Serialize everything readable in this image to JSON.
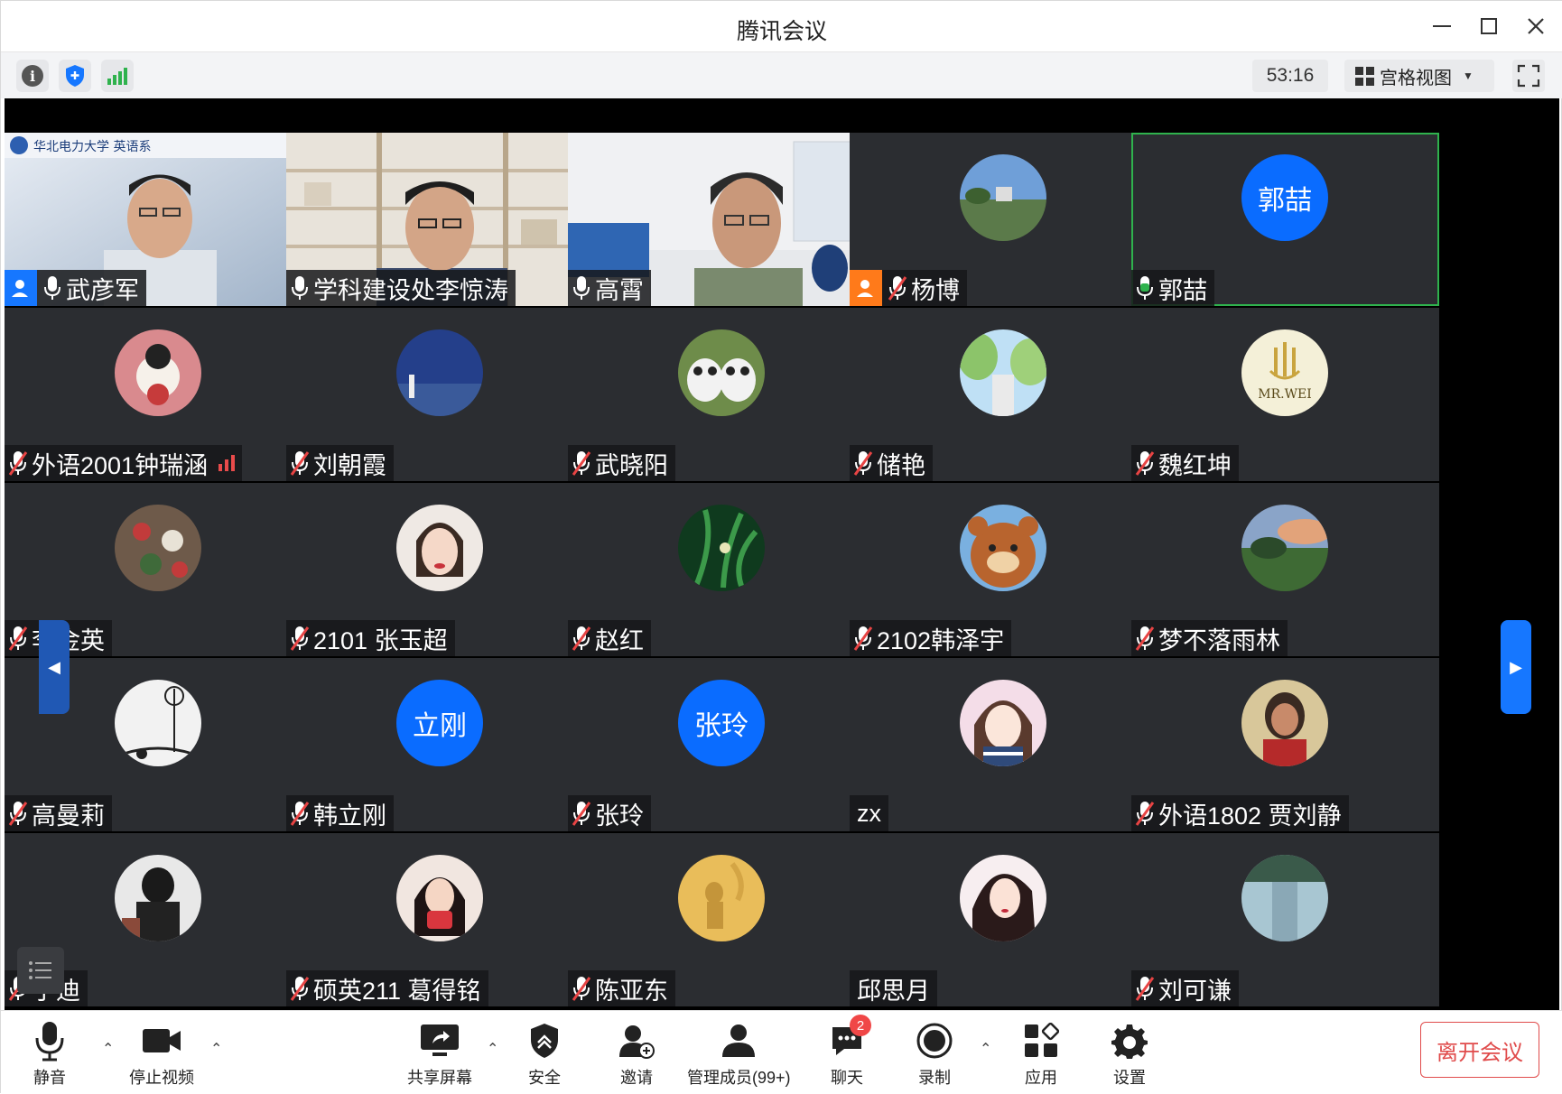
{
  "window": {
    "title": "腾讯会议"
  },
  "infobar": {
    "timer": "53:16",
    "view_mode": "宫格视图"
  },
  "participants": [
    {
      "name": "武彦军",
      "kind": "video",
      "mic": "on",
      "host": true
    },
    {
      "name": "学科建设处李惊涛",
      "kind": "video",
      "mic": "on"
    },
    {
      "name": "高霄",
      "kind": "video",
      "mic": "on"
    },
    {
      "name": "杨博",
      "kind": "photo",
      "mic": "muted",
      "cohost": true
    },
    {
      "name": "郭喆",
      "kind": "initials",
      "initials": "郭喆",
      "mic": "active"
    },
    {
      "name": "外语2001钟瑞涵",
      "kind": "photo",
      "mic": "muted",
      "signal": true
    },
    {
      "name": "刘朝霞",
      "kind": "photo",
      "mic": "muted"
    },
    {
      "name": "武晓阳",
      "kind": "photo",
      "mic": "muted"
    },
    {
      "name": "储艳",
      "kind": "photo",
      "mic": "muted"
    },
    {
      "name": "魏红坤",
      "kind": "photo",
      "mic": "muted"
    },
    {
      "name": "李金英",
      "kind": "photo",
      "mic": "muted"
    },
    {
      "name": "2101 张玉超",
      "kind": "photo",
      "mic": "muted"
    },
    {
      "name": "赵红",
      "kind": "photo",
      "mic": "muted"
    },
    {
      "name": "2102韩泽宇",
      "kind": "photo",
      "mic": "muted"
    },
    {
      "name": "梦不落雨林",
      "kind": "photo",
      "mic": "muted"
    },
    {
      "name": "高曼莉",
      "kind": "photo",
      "mic": "muted"
    },
    {
      "name": "韩立刚",
      "kind": "initials",
      "initials": "立刚",
      "mic": "muted"
    },
    {
      "name": "张玲",
      "kind": "initials",
      "initials": "张玲",
      "mic": "muted"
    },
    {
      "name": "zx",
      "kind": "photo",
      "mic": "none"
    },
    {
      "name": "外语1802 贾刘静",
      "kind": "photo",
      "mic": "muted"
    },
    {
      "name": "于迪",
      "kind": "photo",
      "mic": "muted"
    },
    {
      "name": "硕英211 葛得铭",
      "kind": "photo",
      "mic": "muted"
    },
    {
      "name": "陈亚东",
      "kind": "photo",
      "mic": "muted"
    },
    {
      "name": "邱思月",
      "kind": "photo",
      "mic": "none"
    },
    {
      "name": "刘可谦",
      "kind": "photo",
      "mic": "muted"
    }
  ],
  "avatar_logo_text": "MR.WEI",
  "toolbar": {
    "mute": "静音",
    "stop_video": "停止视频",
    "share_screen": "共享屏幕",
    "security": "安全",
    "invite": "邀请",
    "manage_members": "管理成员(99+)",
    "chat": "聊天",
    "chat_badge": "2",
    "record": "录制",
    "apps": "应用",
    "settings": "设置",
    "leave": "离开会议"
  },
  "colors": {
    "accent": "#0a6cff",
    "leave": "#e04b4b",
    "active_speaker": "#2fb24d",
    "tile_bg": "#2b2d31"
  }
}
